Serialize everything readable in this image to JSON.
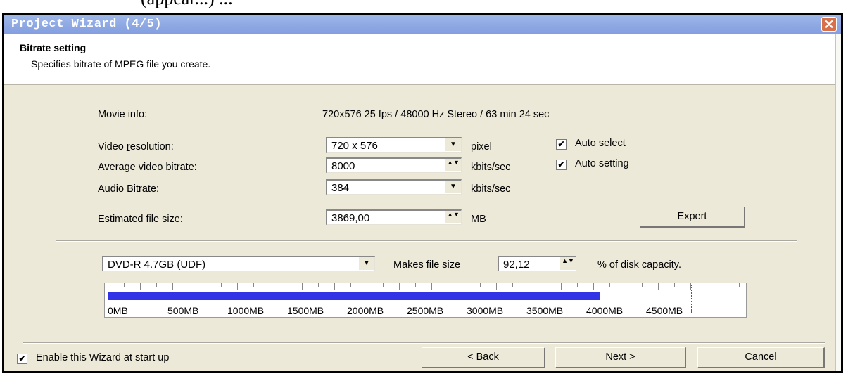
{
  "top_clip_text": "(appear...) ...",
  "window": {
    "title": "Project Wizard (4/5)",
    "close_symbol": "✕"
  },
  "header": {
    "title": "Bitrate setting",
    "subtitle": "Specifies bitrate of MPEG file you create."
  },
  "form": {
    "movie_info_label": "Movie info:",
    "movie_info_value": "720x576 25 fps / 48000 Hz Stereo / 63 min 24 sec",
    "video_resolution_label_pre": "Video ",
    "video_resolution_label_u": "r",
    "video_resolution_label_post": "esolution:",
    "video_resolution_value": "720 x 576",
    "video_resolution_unit": "pixel",
    "avg_bitrate_label_pre": "Average ",
    "avg_bitrate_label_u": "v",
    "avg_bitrate_label_post": "ideo bitrate:",
    "avg_bitrate_value": "8000",
    "avg_bitrate_unit": "kbits/sec",
    "audio_bitrate_label_u": "A",
    "audio_bitrate_label_post": "udio Bitrate:",
    "audio_bitrate_value": "384",
    "audio_bitrate_unit": "kbits/sec",
    "file_size_label_pre": "Estimated ",
    "file_size_label_u": "f",
    "file_size_label_post": "ile size:",
    "file_size_value": "3869,00",
    "file_size_unit": "MB",
    "auto_select_label": "Auto select",
    "auto_select_checked": true,
    "auto_setting_label": "Auto setting",
    "auto_setting_checked": true,
    "expert_label": "Expert"
  },
  "disk": {
    "media_value": "DVD-R 4.7GB (UDF)",
    "makes_file_size_label": "Makes file size",
    "percent_value": "92,12",
    "percent_suffix": "% of disk capacity.",
    "gauge_fill_fraction": 0.7737,
    "gauge_limit_fraction": 0.9209,
    "gauge_labels": [
      "0MB",
      "500MB",
      "1000MB",
      "1500MB",
      "2000MB",
      "2500MB",
      "3000MB",
      "3500MB",
      "4000MB",
      "4500MB"
    ]
  },
  "footer": {
    "enable_wizard_label": "Enable this Wizard at start up",
    "enable_wizard_checked": true,
    "back_label_pre": "< ",
    "back_label_u": "B",
    "back_label_post": "ack",
    "next_label_u": "N",
    "next_label_post": "ext >",
    "cancel_label": "Cancel"
  },
  "icons": {
    "combo_arrow": "▼",
    "spin_arrows": "▲▼",
    "check_mark": "✔"
  },
  "colors": {
    "titlebar": "#8fa9e4",
    "dialog_bg": "#ece9d8",
    "gauge_fill": "#3232e6",
    "limit_line": "#e02020"
  }
}
